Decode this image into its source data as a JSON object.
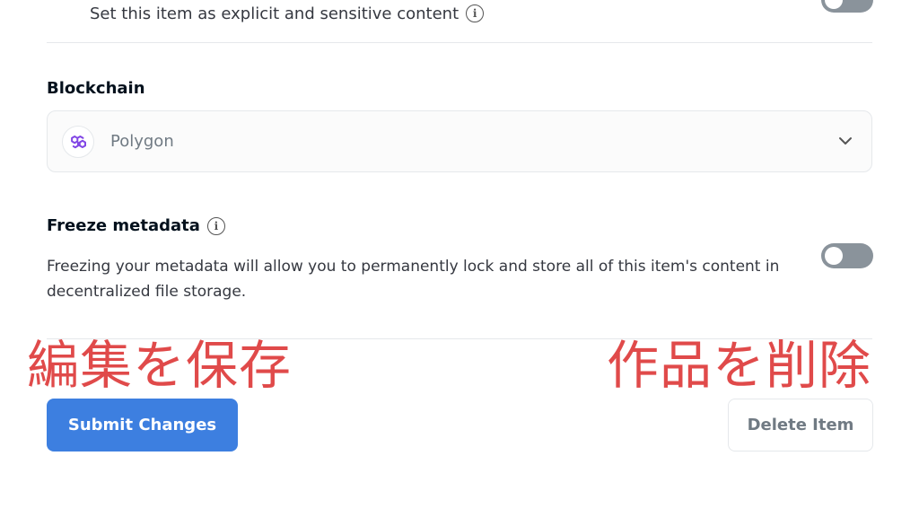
{
  "explicit": {
    "label": "Set this item as explicit and sensitive content",
    "info_glyph": "i",
    "toggle_on": false
  },
  "blockchain": {
    "label": "Blockchain",
    "selected": "Polygon",
    "logo_icon": "polygon-logo-icon",
    "accent": "#8247e5"
  },
  "freeze": {
    "label": "Freeze metadata",
    "info_glyph": "i",
    "description": "Freezing your metadata will allow you to permanently lock and store all of this item's content in decentralized file storage.",
    "toggle_on": false
  },
  "annotations": {
    "save": "編集を保存",
    "delete": "作品を削除",
    "color": "#e04a4a"
  },
  "actions": {
    "submit_label": "Submit Changes",
    "delete_label": "Delete Item",
    "primary_color": "#3d7fe0"
  }
}
